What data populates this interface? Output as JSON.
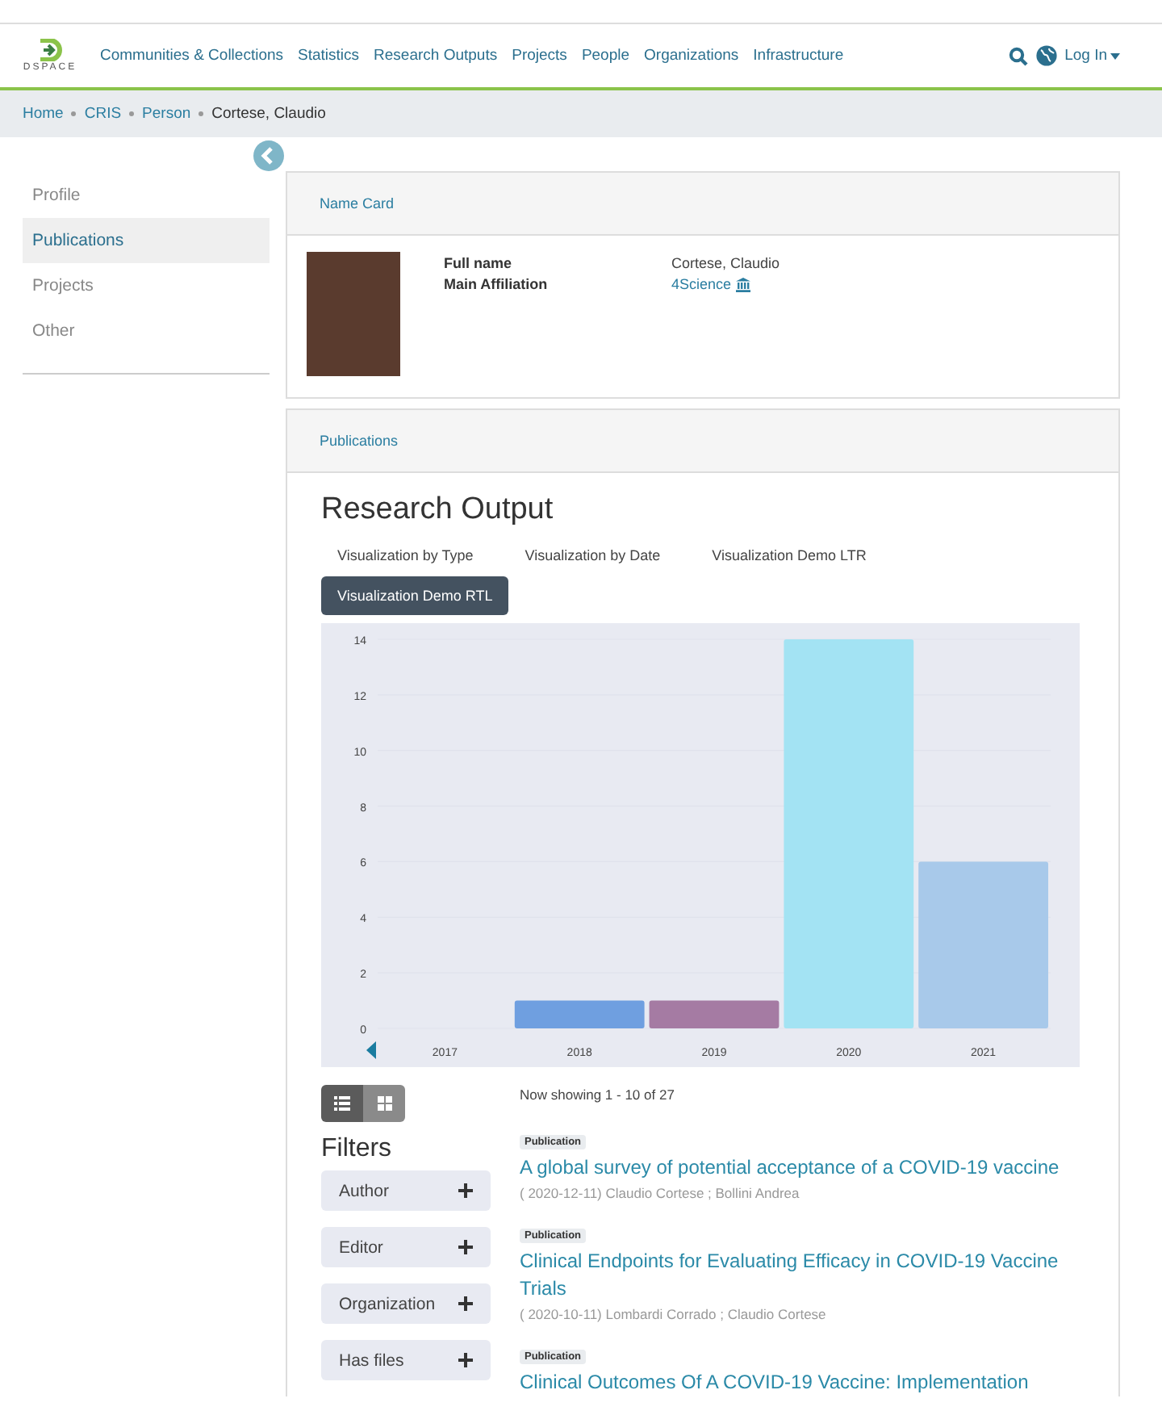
{
  "header": {
    "logo_text": "DSPACE",
    "nav": [
      "Communities & Collections",
      "Statistics",
      "Research Outputs",
      "Projects",
      "People",
      "Organizations",
      "Infrastructure"
    ],
    "login": "Log In"
  },
  "breadcrumb": [
    {
      "label": "Home",
      "link": true
    },
    {
      "label": "CRIS",
      "link": true
    },
    {
      "label": "Person",
      "link": true
    },
    {
      "label": "Cortese, Claudio",
      "link": false
    }
  ],
  "sidebar": {
    "items": [
      {
        "label": "Profile",
        "selected": false
      },
      {
        "label": "Publications",
        "selected": true
      },
      {
        "label": "Projects",
        "selected": false
      },
      {
        "label": "Other",
        "selected": false
      }
    ]
  },
  "name_card": {
    "title": "Name Card",
    "fields": [
      {
        "label": "Full name",
        "value": "Cortese, Claudio",
        "kind": "text"
      },
      {
        "label": "Main Affiliation",
        "value": "4Science",
        "kind": "link"
      }
    ]
  },
  "publications": {
    "title": "Publications",
    "heading": "Research Output",
    "tabs": [
      {
        "label": "Visualization by Type",
        "selected": false
      },
      {
        "label": "Visualization by Date",
        "selected": false
      },
      {
        "label": "Visualization Demo LTR",
        "selected": false
      },
      {
        "label": "Visualization Demo RTL",
        "selected": true
      }
    ],
    "chart_data": {
      "type": "bar",
      "categories": [
        "2017",
        "2018",
        "2019",
        "2020",
        "2021"
      ],
      "values": [
        0,
        1,
        1,
        14,
        6
      ],
      "grid": true,
      "colors": [
        null,
        "#6f9fe0",
        "#a57ba3",
        "#a3e3f3",
        "#a8c9ea"
      ],
      "ylim": [
        0,
        14
      ],
      "yticks": [
        0,
        2,
        4,
        6,
        8,
        10,
        12,
        14
      ]
    },
    "view_modes": [
      {
        "kind": "list",
        "selected": true
      },
      {
        "kind": "grid",
        "selected": false
      }
    ],
    "filters_title": "Filters",
    "filters": [
      "Author",
      "Editor",
      "Organization",
      "Has files"
    ],
    "results_count": "Now showing 1 - 10 of 27",
    "results": [
      {
        "type": "Publication",
        "title": "A global survey of potential acceptance of a COVID-19 vaccine",
        "meta": "( 2020-12-11) Claudio Cortese ; Bollini Andrea"
      },
      {
        "type": "Publication",
        "title": "Clinical Endpoints for Evaluating Efficacy in COVID-19 Vaccine Trials",
        "meta": "( 2020-10-11) Lombardi Corrado ; Claudio Cortese"
      },
      {
        "type": "Publication",
        "title": "Clinical Outcomes Of A COVID-19 Vaccine: Implementation"
      }
    ]
  }
}
